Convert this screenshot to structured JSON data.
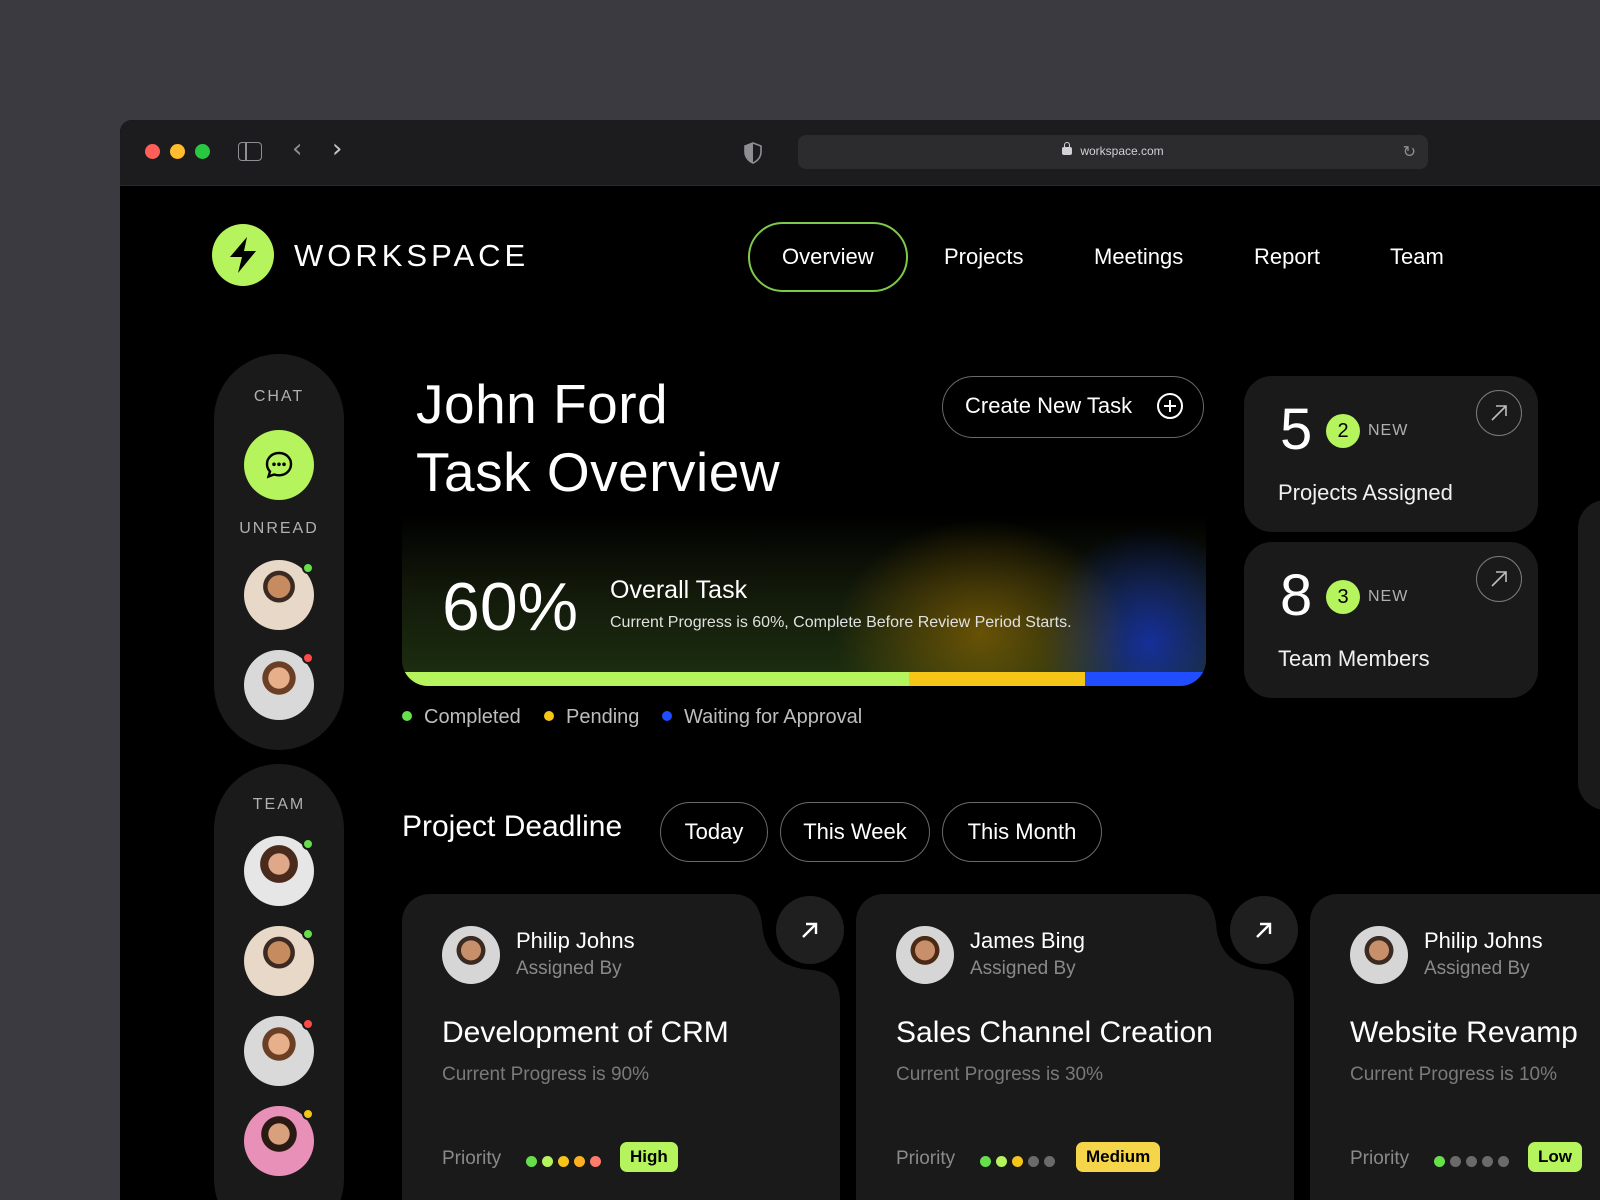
{
  "browser": {
    "url": "workspace.com"
  },
  "brand": {
    "name": "WORKSPACE",
    "accent": "#b5f45c"
  },
  "nav": [
    {
      "label": "Overview",
      "active": true
    },
    {
      "label": "Projects"
    },
    {
      "label": "Meetings"
    },
    {
      "label": "Report"
    },
    {
      "label": "Team"
    }
  ],
  "sidebar": {
    "chat_label": "CHAT",
    "unread_label": "UNREAD",
    "team_label": "TEAM",
    "unread": [
      {
        "avatar": "man-beard-suit",
        "status": "online",
        "status_color": "#66e04a"
      },
      {
        "avatar": "woman-smiling",
        "status": "busy",
        "status_color": "#ff4a4a"
      }
    ],
    "team": [
      {
        "avatar": "woman-curly-hair",
        "status_color": "#66e04a"
      },
      {
        "avatar": "man-beard-suit",
        "status_color": "#66e04a"
      },
      {
        "avatar": "woman-smiling",
        "status_color": "#ff4a4a"
      },
      {
        "avatar": "woman-pink",
        "status_color": "#f5c518"
      }
    ]
  },
  "overview": {
    "title_line1": "John Ford",
    "title_line2": "Task Overview",
    "create_button": "Create New Task",
    "percent": "60%",
    "overall_label": "Overall Task",
    "overall_sub": "Current Progress is 60%, Complete Before Review Period Starts.",
    "progress": [
      {
        "label": "Completed",
        "fraction": 0.63,
        "color": "#b5f45c"
      },
      {
        "label": "Pending",
        "fraction": 0.22,
        "color": "#f5c518"
      },
      {
        "label": "Waiting for Approval",
        "fraction": 0.15,
        "color": "#1f4dff"
      }
    ]
  },
  "stats": [
    {
      "value": "5",
      "new_count": "2",
      "new_label": "NEW",
      "label": "Projects Assigned"
    },
    {
      "value": "8",
      "new_count": "3",
      "new_label": "NEW",
      "label": "Team Members"
    }
  ],
  "deadline": {
    "title": "Project Deadline",
    "filters": [
      "Today",
      "This Week",
      "This Month"
    ]
  },
  "tasks": [
    {
      "name": "Philip Johns",
      "assigned": "Assigned By",
      "title": "Development of CRM",
      "progress": "Current Progress is 90%",
      "priority_label": "Priority",
      "priority": "High",
      "priority_color": "#b5f45c",
      "dots": [
        "#66e04a",
        "#b5f45c",
        "#f5c518",
        "#ffb020",
        "#ff7a6a"
      ]
    },
    {
      "name": "James Bing",
      "assigned": "Assigned By",
      "title": "Sales Channel Creation",
      "progress": "Current Progress is 30%",
      "priority_label": "Priority",
      "priority": "Medium",
      "priority_color": "#f5d54a",
      "dots": [
        "#66e04a",
        "#b5f45c",
        "#f5c518",
        "#6a6a6a",
        "#6a6a6a"
      ]
    },
    {
      "name": "Philip Johns",
      "assigned": "Assigned By",
      "title": "Website Revamp",
      "progress": "Current Progress is 10%",
      "priority_label": "Priority",
      "priority": "Low",
      "priority_color": "#b5f45c",
      "dots": [
        "#66e04a",
        "#6a6a6a",
        "#6a6a6a",
        "#6a6a6a",
        "#6a6a6a"
      ]
    }
  ]
}
